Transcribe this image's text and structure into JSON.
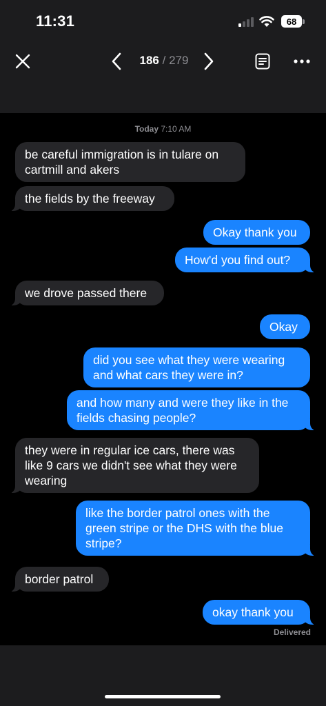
{
  "status_bar": {
    "time": "11:31",
    "battery": "68"
  },
  "nav": {
    "current": "186",
    "separator": "/",
    "total": "279"
  },
  "conversation": {
    "timestamp_day": "Today",
    "timestamp_time": "7:10 AM",
    "messages": [
      {
        "from": "them",
        "text": "be careful immigration is in tulare on cartmill and akers"
      },
      {
        "from": "them",
        "text": "the fields by the freeway"
      },
      {
        "from": "me",
        "text": "Okay thank you"
      },
      {
        "from": "me",
        "text": "How'd you find out?"
      },
      {
        "from": "them",
        "text": "we drove passed there"
      },
      {
        "from": "me",
        "text": "Okay"
      },
      {
        "from": "me",
        "text": "did you see what they were wearing and what cars they were in?"
      },
      {
        "from": "me",
        "text": "and how many and were they like in the fields chasing people?"
      },
      {
        "from": "them",
        "text": "they were in regular ice cars, there was like 9 cars we didn't see what they were wearing"
      },
      {
        "from": "me",
        "text": "like the border patrol ones with the green stripe or the DHS with the blue stripe?"
      },
      {
        "from": "them",
        "text": "border patrol"
      },
      {
        "from": "me",
        "text": "okay thank you"
      }
    ],
    "delivery_status": "Delivered"
  },
  "colors": {
    "outgoing_bubble": "#1a84ff",
    "incoming_bubble": "#262629",
    "chrome": "#1c1c1e"
  },
  "icons": [
    "close-icon",
    "chevron-left-icon",
    "chevron-right-icon",
    "document-icon",
    "more-icon",
    "wifi-icon",
    "signal-icon",
    "battery-icon"
  ]
}
